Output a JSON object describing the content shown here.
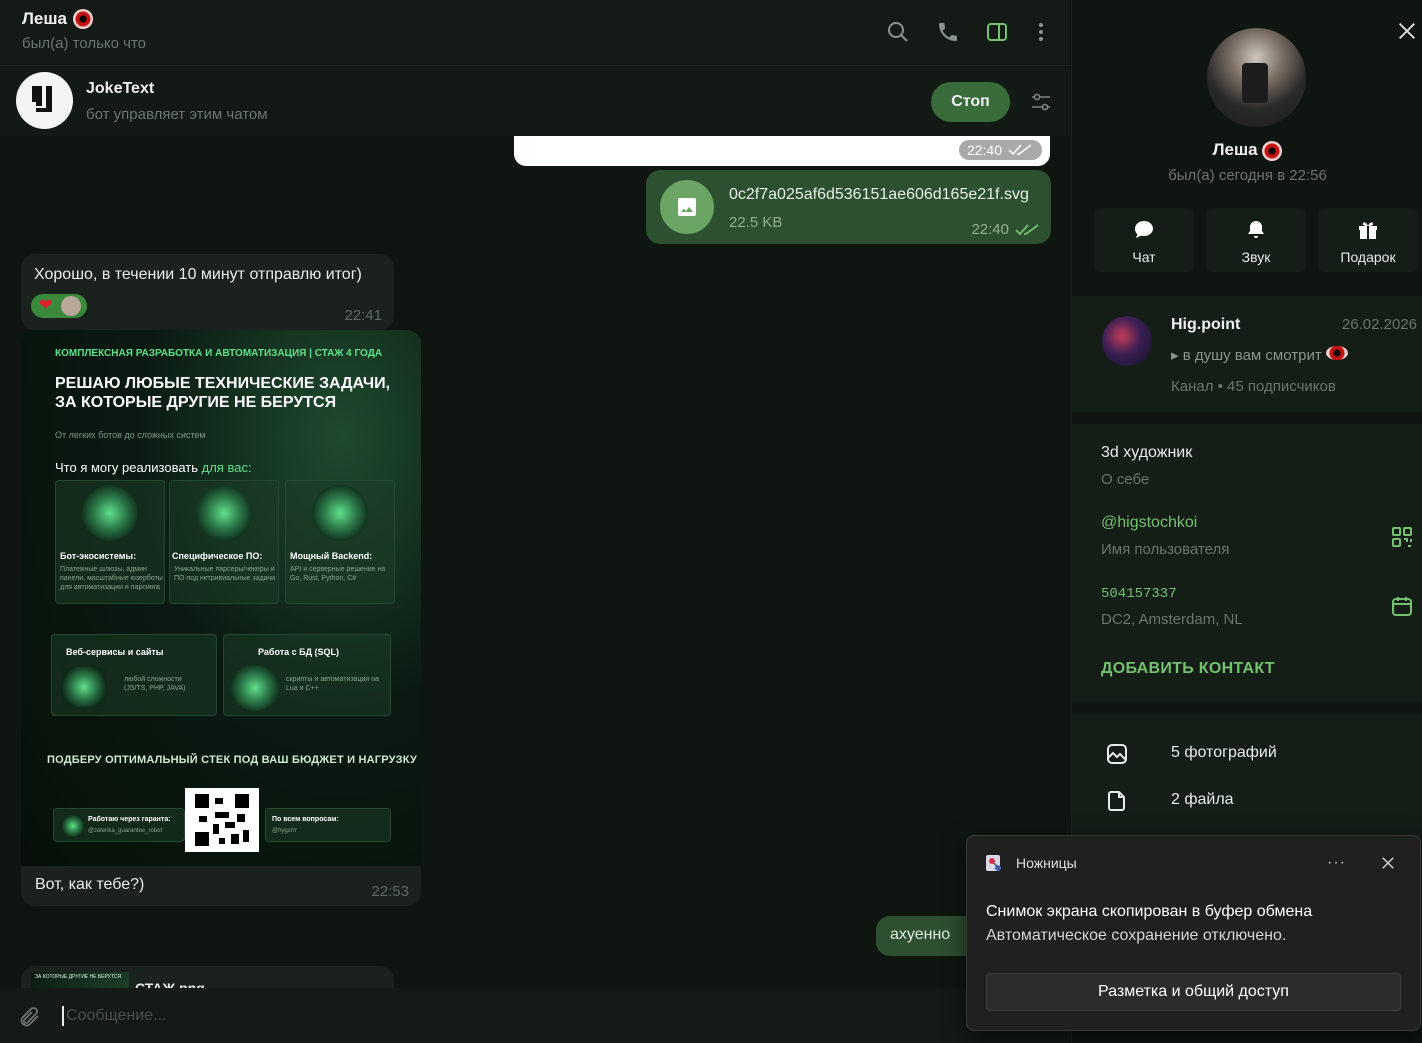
{
  "header": {
    "name": "Леша",
    "status": "был(а) только что"
  },
  "bot": {
    "name": "JokeText",
    "subtitle": "бот управляет этим чатом",
    "stop_label": "Стоп"
  },
  "messages": {
    "white_time": "22:40",
    "file": {
      "name": "0c2f7a025af6d536151ae606d165e21f.svg",
      "size": "22.5 KB",
      "time": "22:40"
    },
    "incoming1": {
      "text": "Хорошо, в течении 10 минут отправлю итог)",
      "time": "22:41"
    },
    "poster": {
      "top": "КОМПЛЕКСНАЯ РАЗРАБОТКА И АВТОМАТИЗАЦИЯ | СТАЖ 4 ГОДА",
      "headline": "РЕШАЮ ЛЮБЫЕ ТЕХНИЧЕСКИЕ ЗАДАЧИ, ЗА КОТОРЫЕ ДРУГИЕ НЕ БЕРУТСЯ",
      "sub": "От легких ботов до сложных систем",
      "can_prefix": "Что я могу реализовать",
      "can_accent": "для вас:",
      "cards": [
        {
          "title": "Бот-экосистемы:",
          "text": "Платежные шлюзы, админ панели, масштабные юзерботы для автоматизации и парсинга"
        },
        {
          "title": "Специфическое ПО:",
          "text": "Уникальные парсеры/чекеры и ПО под нетривиальные задачи"
        },
        {
          "title": "Мощный Backend:",
          "text": "API и серверные решение на Go, Rust, Python, C#"
        }
      ],
      "wide_cards": [
        {
          "title": "Веб-сервисы и сайты",
          "text": "любой сложности (JS/TS, PHP, JAVA)"
        },
        {
          "title": "Работа с БД (SQL)",
          "text": "скрипты и автоматизация на Lua и C++"
        }
      ],
      "middle": "ПОДБЕРУ ОПТИМАЛЬНЫЙ СТЕК ПОД ВАШ БЮДЖЕТ И НАГРУЗКУ",
      "guarantee_title": "Работаю через гаранта:",
      "guarantee_handle": "@zelenka_guarantee_robot",
      "questions_title": "По всем вопросам:",
      "questions_handle": "@hygcrrr"
    },
    "image_caption": "Вот, как тебе?)",
    "image_time": "22:53",
    "outgoing2": "ахуенно",
    "incoming3": {
      "thumb_text": "ЗА КОТОРЫЕ ДРУГИЕ НЕ БЕРУТСЯ",
      "file_name": "СТАЖ.png"
    }
  },
  "composer": {
    "placeholder": "Сообщение..."
  },
  "profile": {
    "name": "Леша",
    "status": "был(а) сегодня в 22:56",
    "actions": [
      "Чат",
      "Звук",
      "Подарок"
    ],
    "channel": {
      "name": "Hig.point",
      "date": "26.02.2026",
      "last": "в душу вам смотрит",
      "meta": "Канал • 45 подписчиков"
    },
    "bio": "3d художник",
    "bio_label": "О себе",
    "username": "@higstochkoi",
    "username_label": "Имя пользователя",
    "id": "504157337",
    "dc": "DC2, Amsterdam, NL",
    "add_contact": "ДОБАВИТЬ КОНТАКТ",
    "photos": "5 фотографий",
    "files": "2 файла"
  },
  "toast": {
    "app": "Ножницы",
    "more": "···",
    "title": "Снимок экрана скопирован в буфер обмена",
    "body": "Автоматическое сохранение отключено.",
    "button": "Разметка и общий доступ"
  },
  "colors": {
    "accent": "#74c270",
    "bubble_out": "#2d5030",
    "bubble_in": "#1b221d",
    "stop_button": "#3a6b3a"
  }
}
